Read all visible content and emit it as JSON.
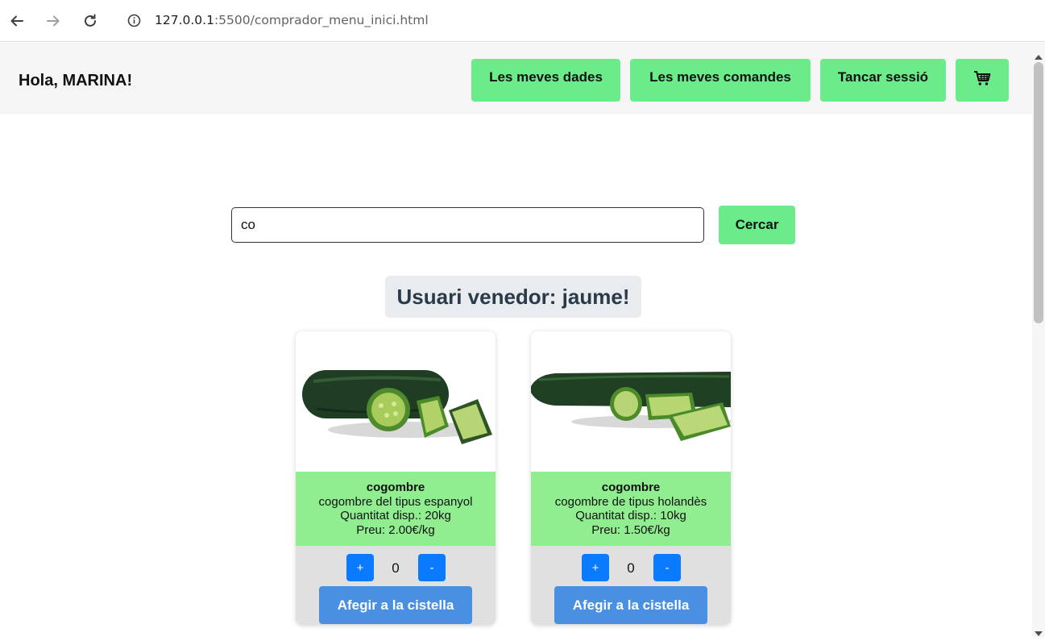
{
  "browser": {
    "url_host": "127.0.0.1",
    "url_path": ":5500/comprador_menu_inici.html"
  },
  "header": {
    "greeting": "Hola, MARINA!",
    "buttons": [
      "Les meves dades",
      "Les meves comandes",
      "Tancar sessió"
    ],
    "cart_icon": "shopping-cart-icon"
  },
  "search": {
    "value": "co",
    "button": "Cercar"
  },
  "seller": {
    "title": "Usuari venedor: jaume!"
  },
  "products": [
    {
      "name": "cogombre",
      "description": "cogombre del tipus espanyol",
      "quantity": "Quantitat disp.: 20kg",
      "price": "Preu: 2.00€/kg",
      "qty": "0",
      "plus": "+",
      "minus": "-",
      "add": "Afegir a la cistella"
    },
    {
      "name": "cogombre",
      "description": "cogombre de tipus holandès",
      "quantity": "Quantitat disp.: 10kg",
      "price": "Preu: 1.50€/kg",
      "qty": "0",
      "plus": "+",
      "minus": "-",
      "add": "Afegir a la cistella"
    }
  ],
  "colors": {
    "accent_green": "#6ceb8b",
    "info_green": "#90ee90",
    "qty_blue": "#0a7bff",
    "add_blue": "#4a90e2"
  }
}
